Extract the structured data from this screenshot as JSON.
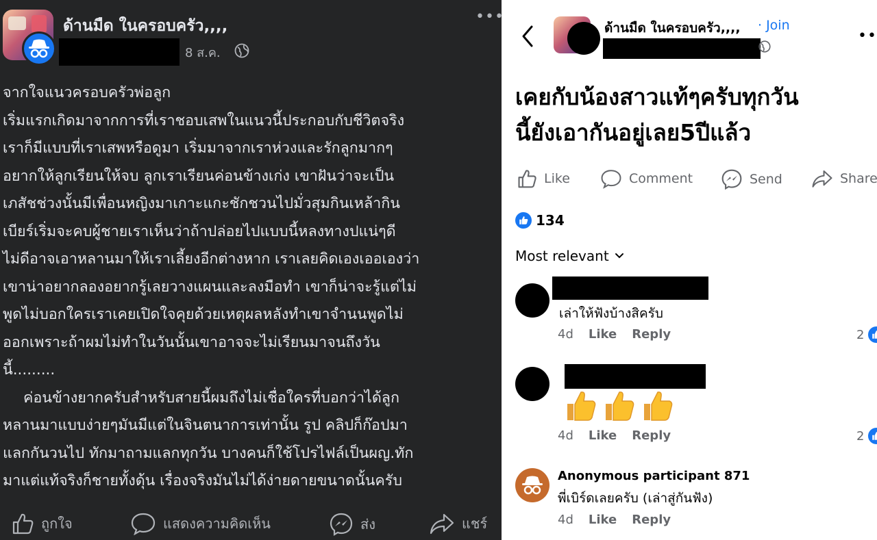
{
  "left_post": {
    "group_name": "ด้านมืด ในครอบครัว,,,,",
    "date": "8 ส.ค.",
    "body_lines": [
      "จากใจแนวครอบครัวพ่อลูก",
      "เริ่มแรกเกิดมาจากการที่เราชอบเสพในแนวนี้ประกอบกับชีวิตจริง",
      "เราก็มีแบบที่เราเสพหรือดูมา เริ่มมาจากเราห่วงและรักลูกมากๆ",
      "อยากให้ลูกเรียนให้จบ ลูกเราเรียนค่อนข้างเก่ง  เขาฝันว่าจะเป็น",
      "เภสัชช่วงนั้นมีเพื่อนหญิงมาเกาะแกะชักชวนไปมั่วสุมกินเหล้ากิน",
      "เบียร์เริ่มจะคบผู้ชายเราเห็นว่าถ้าปล่อยไปแบบนี้หลงทางปแน่ๆดี",
      "ไม่ดีอาจเอาหลานมาให้เราเลี้ยงอีกต่างหาก เราเลยคิดเองเออเองว่า",
      "เขาน่าอยากลองอยากรู้เลยวางแผนและลงมือทำ เขาก็น่าจะรู้แต่ไม่",
      "พูดไม่บอกใครเราเคยเปิดใจคุยด้วยเหตุผลหลังทำเขาจำนนพูดไม่",
      "ออกเพราะถ้าผมไม่ทำในวันนั้นเขาอาจจะไม่เรียนมาจนถึงวัน",
      "นี้.........",
      "ค่อนข้างยากครับสำหรับสายนี้ผมถึงไม่เชื่อใครที่บอกว่าได้ลูก",
      "หลานมาแบบง่ายๆมันมีแต่ในจินตนาการเท่านั้น รูป คลิปก็ก๊อปมา",
      "แลกกันวนไป ทักมาถามแลกทุกวัน บางคนก็ใช้โปรไฟล์เป็นผญ.ทัก",
      "มาแต่แท้จริงก็ชายทั้งดุ้น เรื่องจริงมันไม่ได้ง่ายดายขนาดนั้นครับ"
    ],
    "actions": {
      "like": "ถูกใจ",
      "comment": "แสดงความคิดเห็น",
      "send": "ส่ง",
      "share": "แชร์"
    }
  },
  "right_post": {
    "group_name": "ด้านมืด ในครอบครัว,,,,",
    "join_label": "· Join",
    "title_lines": [
      "เคยกับน้องสาวแท้ๆครับทุกวัน",
      "นี้ยังเอากันอยู่เลย5ปีแล้ว"
    ],
    "actions": {
      "like": "Like",
      "comment": "Comment",
      "send": "Send",
      "share": "Share"
    },
    "reaction_count": "134",
    "sort_label": "Most relevant",
    "comments": [
      {
        "text": "เล่าให้ฟังบ้างสิครับ",
        "time": "4d",
        "like": "Like",
        "reply": "Reply",
        "count": "2"
      },
      {
        "text": "",
        "time": "4d",
        "like": "Like",
        "reply": "Reply",
        "count": "2"
      },
      {
        "name": "Anonymous participant 871",
        "text": "พี่เบิร์ดเลยครับ (เล่าสู่กันฟัง)",
        "time": "4d",
        "like": "Like",
        "reply": "Reply"
      }
    ]
  },
  "colors": {
    "left_bg": "#242526",
    "facebook_blue": "#1877f2",
    "secondary_text": "#65676b"
  }
}
